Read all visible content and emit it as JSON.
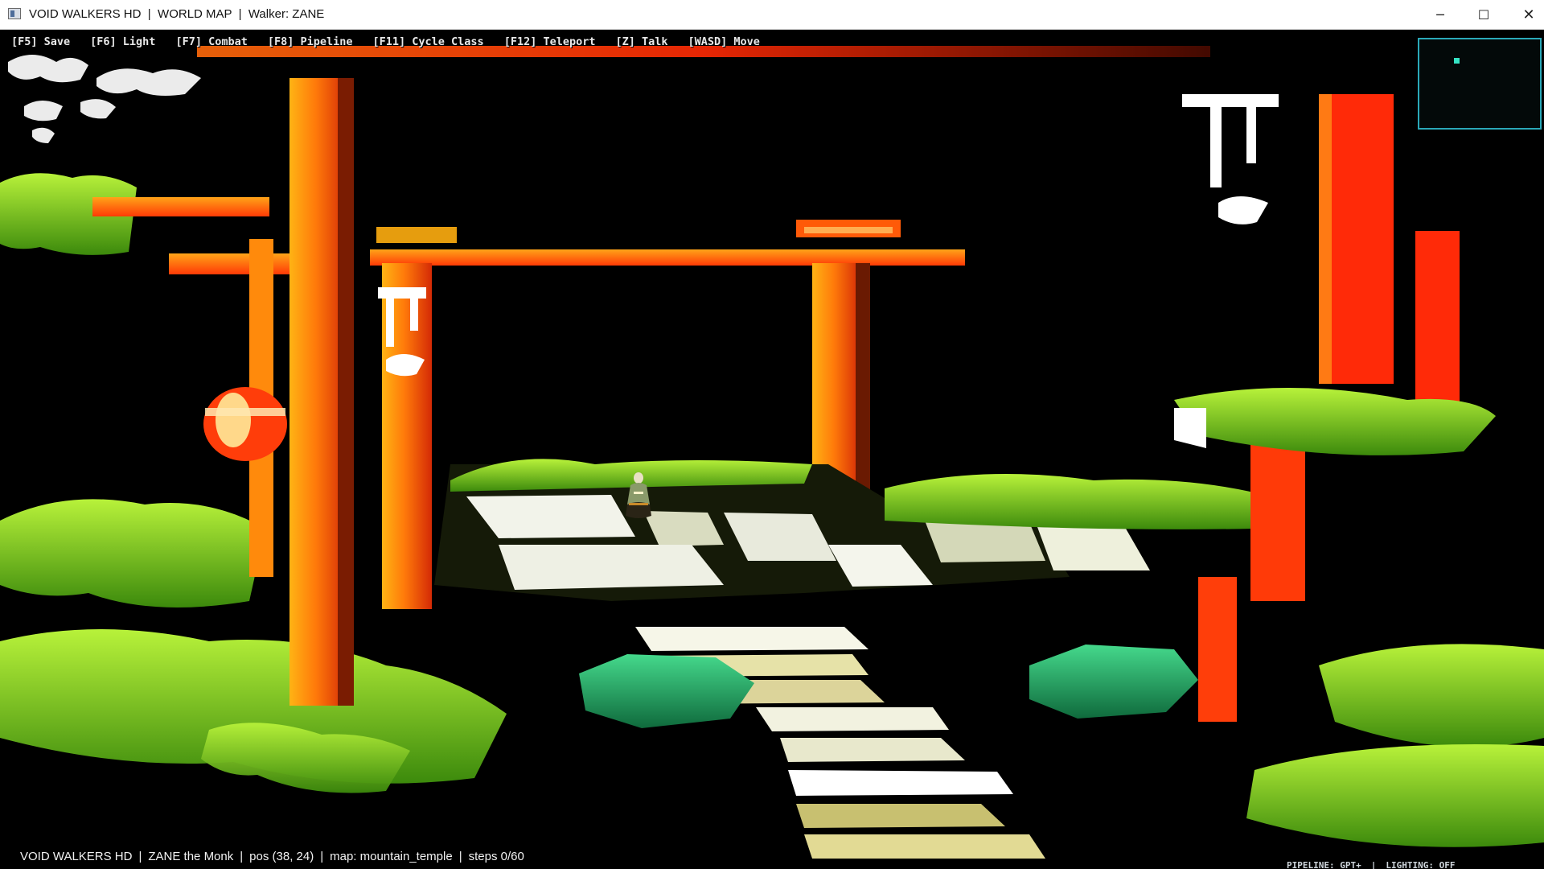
{
  "window": {
    "title": "VOID WALKERS HD  |  WORLD MAP  |  Walker: ZANE",
    "controls": {
      "minimize": "─",
      "maximize": "☐",
      "close": "✕"
    }
  },
  "hotkeys": [
    "[F5] Save",
    "[F6] Light",
    "[F7] Combat",
    "[F8] Pipeline",
    "[F11] Cycle Class",
    "[F12] Teleport",
    "[Z] Talk",
    "[WASD] Move"
  ],
  "status": {
    "game": "VOID WALKERS HD",
    "character": "ZANE the Monk",
    "position": "pos (38, 24)",
    "map": "map: mountain_temple",
    "steps": "steps 0/60"
  },
  "debug": {
    "pipeline": "PIPELINE: GPT+",
    "lighting": "LIGHTING: OFF"
  },
  "minimap": {
    "border_color": "#2aa8b8",
    "player_color": "#35e3c4"
  },
  "colors": {
    "torii_red": "#ff4a08",
    "torii_orange": "#ffae10",
    "foliage": "#8fe41c",
    "rock_green": "#1fa86a"
  }
}
